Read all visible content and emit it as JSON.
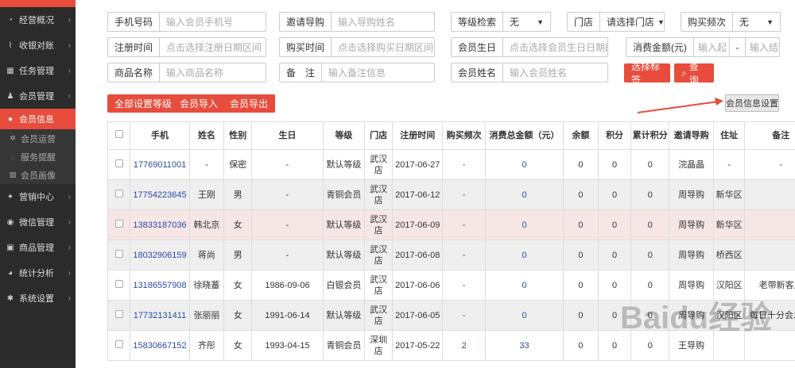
{
  "sidebar": {
    "items": [
      {
        "icon": "dashboard-icon",
        "label": "经营概况"
      },
      {
        "icon": "chart-icon",
        "label": "收银对账"
      },
      {
        "icon": "calendar-icon",
        "label": "任务管理"
      },
      {
        "icon": "users-icon",
        "label": "会员管理"
      }
    ],
    "active": "会员信息",
    "subs": [
      {
        "icon": "gear-icon",
        "label": "会员运营"
      },
      {
        "icon": "comment-icon",
        "label": "服务提醒"
      },
      {
        "icon": "image-icon",
        "label": "会员画像"
      }
    ],
    "items2": [
      {
        "icon": "gift-icon",
        "label": "营销中心"
      },
      {
        "icon": "wechat-icon",
        "label": "微信管理"
      },
      {
        "icon": "cubes-icon",
        "label": "商品管理"
      },
      {
        "icon": "pie-icon",
        "label": "统计分析"
      },
      {
        "icon": "cog-icon",
        "label": "系统设置"
      }
    ]
  },
  "filters": {
    "phone": {
      "label": "手机号码",
      "placeholder": "输入会员手机号"
    },
    "guide": {
      "label": "邀请导购",
      "placeholder": "输入导购姓名"
    },
    "level": {
      "label": "等级检索",
      "value": "无"
    },
    "store": {
      "label": "门店",
      "value": "请选择门店"
    },
    "freq": {
      "label": "购买频次",
      "value": "无"
    },
    "regtime": {
      "label": "注册时间",
      "placeholder": "点击选择注册日期区间"
    },
    "buytime": {
      "label": "购买时间",
      "placeholder": "点击选择购买日期区间"
    },
    "birthday": {
      "label": "会员生日",
      "placeholder": "点击选择会员生日日期的区"
    },
    "amount": {
      "label": "消费金额(元)",
      "from": "输入起",
      "sep": "-",
      "to": "输入结"
    },
    "goods": {
      "label": "商品名称",
      "placeholder": "输入商品名称"
    },
    "remark": {
      "label": "备　注",
      "placeholder": "输入备注信息"
    },
    "name": {
      "label": "会员姓名",
      "placeholder": "输入会员姓名"
    },
    "select_tag": "选择标签",
    "search": "查询"
  },
  "actions": {
    "set_all": "全部设置等级",
    "import": "会员导入",
    "export": "会员导出",
    "settings": "会员信息设置"
  },
  "table": {
    "headers": [
      "手机",
      "姓名",
      "性别",
      "生日",
      "等级",
      "门店",
      "注册时间",
      "购买频次",
      "消费总金额（元）",
      "余额",
      "积分",
      "累计积分",
      "邀请导购",
      "住址",
      "备注"
    ],
    "rows": [
      [
        "17769011001",
        "-",
        "保密",
        "-",
        "默认等级",
        "武汉店",
        "2017-06-27",
        "-",
        "0",
        "0",
        "0",
        "0",
        "浣晶晶",
        "-",
        "-"
      ],
      [
        "17754223645",
        "王刚",
        "男",
        "-",
        "青铜会员",
        "武汉店",
        "2017-06-12",
        "-",
        "0",
        "0",
        "0",
        "0",
        "周导购",
        "新华区",
        ""
      ],
      [
        "13833187036",
        "韩北京",
        "女",
        "-",
        "默认等级",
        "武汉店",
        "2017-06-09",
        "-",
        "0",
        "0",
        "0",
        "0",
        "周导购",
        "新华区",
        ""
      ],
      [
        "18032906159",
        "蒋尚",
        "男",
        "-",
        "默认等级",
        "武汉店",
        "2017-06-08",
        "-",
        "0",
        "0",
        "0",
        "0",
        "周导购",
        "桥西区",
        ""
      ],
      [
        "13186557908",
        "徐晓蕃",
        "女",
        "1986-09-06",
        "白银会员",
        "武汉店",
        "2017-06-06",
        "-",
        "0",
        "0",
        "0",
        "0",
        "周导购",
        "汉阳区",
        "老带新客户"
      ],
      [
        "17732131411",
        "张丽丽",
        "女",
        "1991-06-14",
        "默认等级",
        "武汉店",
        "2017-06-05",
        "-",
        "0",
        "0",
        "0",
        "0",
        "周导购",
        "汉阳区",
        "每日十分会发 M"
      ],
      [
        "15830667152",
        "齐彤",
        "女",
        "1993-04-15",
        "青铜会员",
        "深圳店",
        "2017-05-22",
        "2",
        "33",
        "0",
        "0",
        "0",
        "王导购",
        "",
        ""
      ]
    ]
  },
  "watermark": "Baidu经验"
}
